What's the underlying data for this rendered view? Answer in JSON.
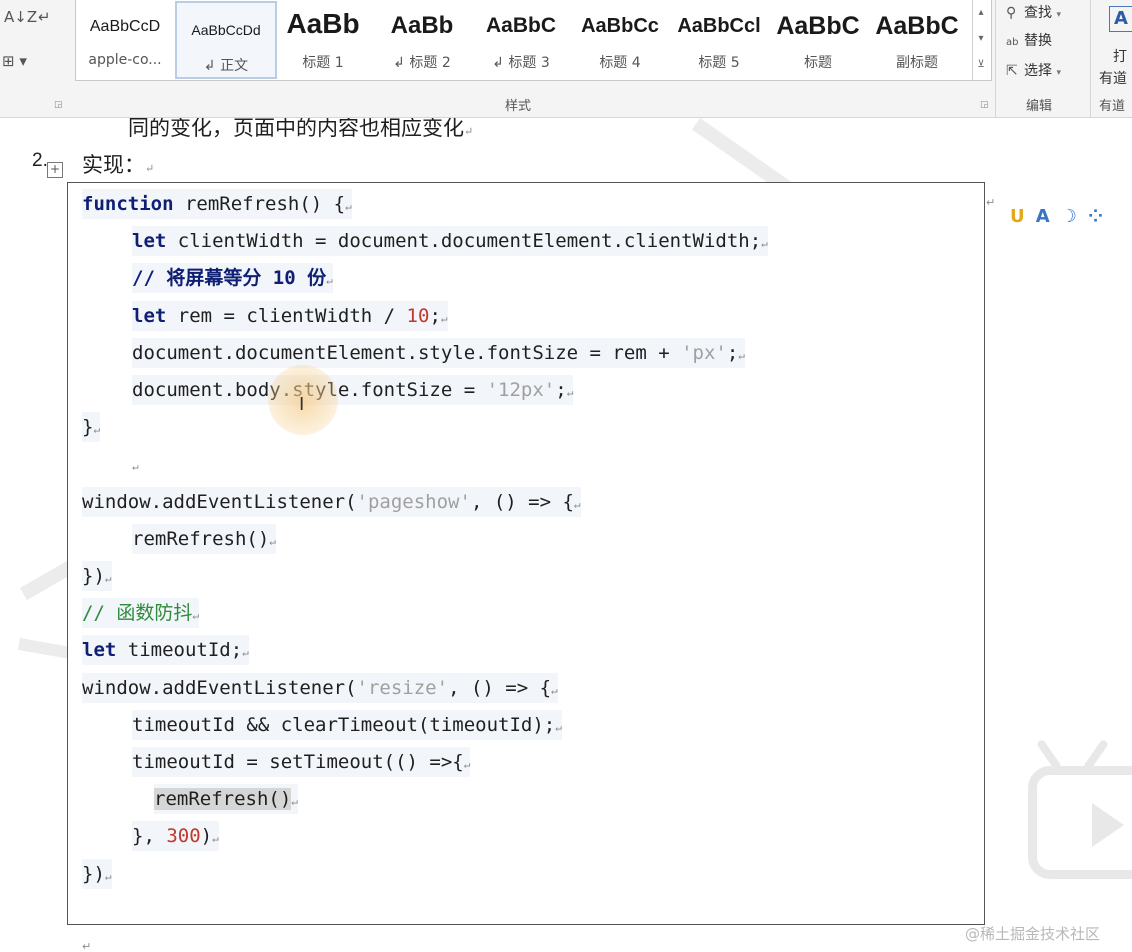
{
  "ribbon": {
    "left_tools": {
      "sort_glyph": "A↓Z",
      "show_marks_glyph": "↵",
      "border_glyph": "⊞ ▾"
    },
    "styles_gallery": [
      {
        "sample": "AaBbCcD",
        "name": "apple-co..."
      },
      {
        "sample": "AaBbCcDd",
        "name": "↲ 正文"
      },
      {
        "sample": "AaBb",
        "name": "标题 1"
      },
      {
        "sample": "AaBb",
        "name": "↲ 标题 2"
      },
      {
        "sample": "AaBbC",
        "name": "↲ 标题 3"
      },
      {
        "sample": "AaBbCc",
        "name": "标题 4"
      },
      {
        "sample": "AaBbCcl",
        "name": "标题 5"
      },
      {
        "sample": "AaBbC",
        "name": "标题"
      },
      {
        "sample": "AaBbC",
        "name": "副标题"
      }
    ],
    "styles_group_label": "样式",
    "edit_group": {
      "find": "查找",
      "replace": "替换",
      "select": "选择",
      "label": "编辑"
    },
    "youdao_group": {
      "glyph": "A",
      "button_text": "打",
      "sub_text": "有道",
      "label": "有道"
    }
  },
  "document": {
    "prev_line": "同的变化，页面中的内容也相应变化",
    "item_number": "2.",
    "item_heading": "实现：",
    "code_lines": [
      {
        "indent": 0,
        "tokens": [
          {
            "t": "function",
            "c": "kw"
          },
          {
            "t": " remRefresh() {",
            "c": ""
          }
        ]
      },
      {
        "indent": 1,
        "tokens": [
          {
            "t": "let",
            "c": "kw"
          },
          {
            "t": " clientWidth = document.documentElement.clientWidth;",
            "c": ""
          }
        ]
      },
      {
        "indent": 1,
        "tokens": [
          {
            "t": "// 将屏幕等分 10 份",
            "c": "cm-blue"
          }
        ]
      },
      {
        "indent": 1,
        "tokens": [
          {
            "t": "let",
            "c": "kw"
          },
          {
            "t": " rem = clientWidth / ",
            "c": ""
          },
          {
            "t": "10",
            "c": "num"
          },
          {
            "t": ";",
            "c": ""
          }
        ]
      },
      {
        "indent": 1,
        "tokens": [
          {
            "t": "document.documentElement.style.fontSize = rem + ",
            "c": ""
          },
          {
            "t": "'px'",
            "c": "str"
          },
          {
            "t": ";",
            "c": ""
          }
        ]
      },
      {
        "indent": 1,
        "tokens": [
          {
            "t": "document.body.style.fontSize = ",
            "c": ""
          },
          {
            "t": "'12px'",
            "c": "str"
          },
          {
            "t": ";",
            "c": ""
          }
        ]
      },
      {
        "indent": 0,
        "tokens": [
          {
            "t": "}",
            "c": ""
          }
        ]
      },
      {
        "indent": 1,
        "tokens": [],
        "blank": true
      },
      {
        "indent": 0,
        "tokens": [
          {
            "t": "window.addEventListener(",
            "c": ""
          },
          {
            "t": "'pageshow'",
            "c": "str"
          },
          {
            "t": ", () => {",
            "c": ""
          }
        ]
      },
      {
        "indent": 1,
        "tokens": [
          {
            "t": "remRefresh()",
            "c": ""
          }
        ]
      },
      {
        "indent": 0,
        "tokens": [
          {
            "t": "})",
            "c": ""
          }
        ]
      },
      {
        "indent": 0,
        "tokens": [
          {
            "t": "// 函数防抖",
            "c": "cm-green"
          }
        ]
      },
      {
        "indent": 0,
        "tokens": [
          {
            "t": "let",
            "c": "kw"
          },
          {
            "t": " timeoutId;",
            "c": ""
          }
        ]
      },
      {
        "indent": 0,
        "tokens": [
          {
            "t": "window.addEventListener(",
            "c": ""
          },
          {
            "t": "'resize'",
            "c": "str"
          },
          {
            "t": ", () => {",
            "c": ""
          }
        ]
      },
      {
        "indent": 1,
        "tokens": [
          {
            "t": "timeoutId && clearTimeout(timeoutId);",
            "c": ""
          }
        ]
      },
      {
        "indent": 1,
        "tokens": [
          {
            "t": "timeoutId = setTimeout(() =>{",
            "c": ""
          }
        ]
      },
      {
        "indent": 2,
        "tokens": [
          {
            "t": "remRefresh()",
            "c": "hl"
          }
        ]
      },
      {
        "indent": 1,
        "tokens": [
          {
            "t": "}, ",
            "c": ""
          },
          {
            "t": "300",
            "c": "num"
          },
          {
            "t": ")",
            "c": ""
          }
        ]
      },
      {
        "indent": 0,
        "tokens": [
          {
            "t": "})",
            "c": ""
          }
        ]
      }
    ],
    "paragraph_mark": "↵",
    "watermark": "@稀土掘金技术社区"
  },
  "colors": {
    "keyword": "#0f1f73",
    "string": "#a0a0a0",
    "number": "#c0392b",
    "comment_green": "#2e8b3a",
    "code_bg": "#f2f5fa"
  }
}
